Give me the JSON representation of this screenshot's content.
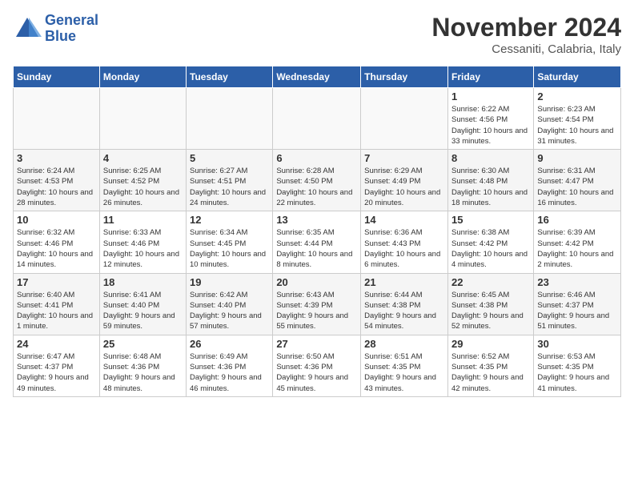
{
  "logo": {
    "line1": "General",
    "line2": "Blue"
  },
  "title": "November 2024",
  "subtitle": "Cessaniti, Calabria, Italy",
  "days_of_week": [
    "Sunday",
    "Monday",
    "Tuesday",
    "Wednesday",
    "Thursday",
    "Friday",
    "Saturday"
  ],
  "weeks": [
    [
      {
        "day": "",
        "info": ""
      },
      {
        "day": "",
        "info": ""
      },
      {
        "day": "",
        "info": ""
      },
      {
        "day": "",
        "info": ""
      },
      {
        "day": "",
        "info": ""
      },
      {
        "day": "1",
        "info": "Sunrise: 6:22 AM\nSunset: 4:56 PM\nDaylight: 10 hours and 33 minutes."
      },
      {
        "day": "2",
        "info": "Sunrise: 6:23 AM\nSunset: 4:54 PM\nDaylight: 10 hours and 31 minutes."
      }
    ],
    [
      {
        "day": "3",
        "info": "Sunrise: 6:24 AM\nSunset: 4:53 PM\nDaylight: 10 hours and 28 minutes."
      },
      {
        "day": "4",
        "info": "Sunrise: 6:25 AM\nSunset: 4:52 PM\nDaylight: 10 hours and 26 minutes."
      },
      {
        "day": "5",
        "info": "Sunrise: 6:27 AM\nSunset: 4:51 PM\nDaylight: 10 hours and 24 minutes."
      },
      {
        "day": "6",
        "info": "Sunrise: 6:28 AM\nSunset: 4:50 PM\nDaylight: 10 hours and 22 minutes."
      },
      {
        "day": "7",
        "info": "Sunrise: 6:29 AM\nSunset: 4:49 PM\nDaylight: 10 hours and 20 minutes."
      },
      {
        "day": "8",
        "info": "Sunrise: 6:30 AM\nSunset: 4:48 PM\nDaylight: 10 hours and 18 minutes."
      },
      {
        "day": "9",
        "info": "Sunrise: 6:31 AM\nSunset: 4:47 PM\nDaylight: 10 hours and 16 minutes."
      }
    ],
    [
      {
        "day": "10",
        "info": "Sunrise: 6:32 AM\nSunset: 4:46 PM\nDaylight: 10 hours and 14 minutes."
      },
      {
        "day": "11",
        "info": "Sunrise: 6:33 AM\nSunset: 4:46 PM\nDaylight: 10 hours and 12 minutes."
      },
      {
        "day": "12",
        "info": "Sunrise: 6:34 AM\nSunset: 4:45 PM\nDaylight: 10 hours and 10 minutes."
      },
      {
        "day": "13",
        "info": "Sunrise: 6:35 AM\nSunset: 4:44 PM\nDaylight: 10 hours and 8 minutes."
      },
      {
        "day": "14",
        "info": "Sunrise: 6:36 AM\nSunset: 4:43 PM\nDaylight: 10 hours and 6 minutes."
      },
      {
        "day": "15",
        "info": "Sunrise: 6:38 AM\nSunset: 4:42 PM\nDaylight: 10 hours and 4 minutes."
      },
      {
        "day": "16",
        "info": "Sunrise: 6:39 AM\nSunset: 4:42 PM\nDaylight: 10 hours and 2 minutes."
      }
    ],
    [
      {
        "day": "17",
        "info": "Sunrise: 6:40 AM\nSunset: 4:41 PM\nDaylight: 10 hours and 1 minute."
      },
      {
        "day": "18",
        "info": "Sunrise: 6:41 AM\nSunset: 4:40 PM\nDaylight: 9 hours and 59 minutes."
      },
      {
        "day": "19",
        "info": "Sunrise: 6:42 AM\nSunset: 4:40 PM\nDaylight: 9 hours and 57 minutes."
      },
      {
        "day": "20",
        "info": "Sunrise: 6:43 AM\nSunset: 4:39 PM\nDaylight: 9 hours and 55 minutes."
      },
      {
        "day": "21",
        "info": "Sunrise: 6:44 AM\nSunset: 4:38 PM\nDaylight: 9 hours and 54 minutes."
      },
      {
        "day": "22",
        "info": "Sunrise: 6:45 AM\nSunset: 4:38 PM\nDaylight: 9 hours and 52 minutes."
      },
      {
        "day": "23",
        "info": "Sunrise: 6:46 AM\nSunset: 4:37 PM\nDaylight: 9 hours and 51 minutes."
      }
    ],
    [
      {
        "day": "24",
        "info": "Sunrise: 6:47 AM\nSunset: 4:37 PM\nDaylight: 9 hours and 49 minutes."
      },
      {
        "day": "25",
        "info": "Sunrise: 6:48 AM\nSunset: 4:36 PM\nDaylight: 9 hours and 48 minutes."
      },
      {
        "day": "26",
        "info": "Sunrise: 6:49 AM\nSunset: 4:36 PM\nDaylight: 9 hours and 46 minutes."
      },
      {
        "day": "27",
        "info": "Sunrise: 6:50 AM\nSunset: 4:36 PM\nDaylight: 9 hours and 45 minutes."
      },
      {
        "day": "28",
        "info": "Sunrise: 6:51 AM\nSunset: 4:35 PM\nDaylight: 9 hours and 43 minutes."
      },
      {
        "day": "29",
        "info": "Sunrise: 6:52 AM\nSunset: 4:35 PM\nDaylight: 9 hours and 42 minutes."
      },
      {
        "day": "30",
        "info": "Sunrise: 6:53 AM\nSunset: 4:35 PM\nDaylight: 9 hours and 41 minutes."
      }
    ]
  ]
}
